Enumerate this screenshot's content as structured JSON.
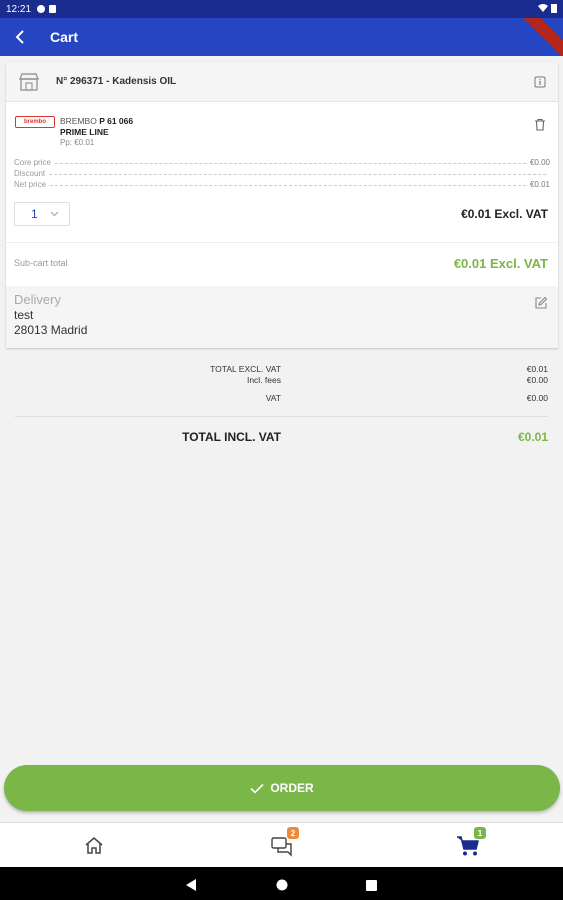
{
  "status_bar": {
    "time": "12:21"
  },
  "app_bar": {
    "title": "Cart"
  },
  "shop": {
    "name": "N° 296371 - Kadensis OIL"
  },
  "product": {
    "brand_logo_text": "brembo",
    "brand": "BREMBO",
    "ref": "P 61 066",
    "line": "PRIME LINE",
    "pp": "Pp: €0.01",
    "prices": [
      {
        "label": "Core price",
        "value": "€0.00"
      },
      {
        "label": "Discount",
        "value": ""
      },
      {
        "label": "Net price",
        "value": "€0.01"
      }
    ],
    "quantity": "1",
    "line_total": "€0.01 Excl. VAT"
  },
  "subtotal": {
    "label": "Sub-cart total",
    "value": "€0.01 Excl. VAT"
  },
  "delivery": {
    "title": "Delivery",
    "line1": "test",
    "line2": "28013 Madrid"
  },
  "totals": {
    "excl_vat_label": "TOTAL EXCL. VAT",
    "excl_vat_value": "€0.01",
    "fees_label": "Incl. fees",
    "fees_value": "€0.00",
    "vat_label": "VAT",
    "vat_value": "€0.00",
    "incl_vat_label": "TOTAL INCL. VAT",
    "incl_vat_value": "€0.01"
  },
  "order_button": {
    "label": "ORDER"
  },
  "bottom_nav": {
    "messages_badge": "2",
    "cart_badge": "1"
  },
  "colors": {
    "primary": "#2545c2",
    "status_bar": "#1b2c8f",
    "accent_green": "#7ab648",
    "badge_orange": "#f0883a"
  },
  "icons": [
    "back-arrow-icon",
    "shop-icon",
    "info-icon",
    "trash-icon",
    "chevron-down-icon",
    "edit-icon",
    "check-icon",
    "home-icon",
    "chat-icon",
    "cart-icon"
  ]
}
